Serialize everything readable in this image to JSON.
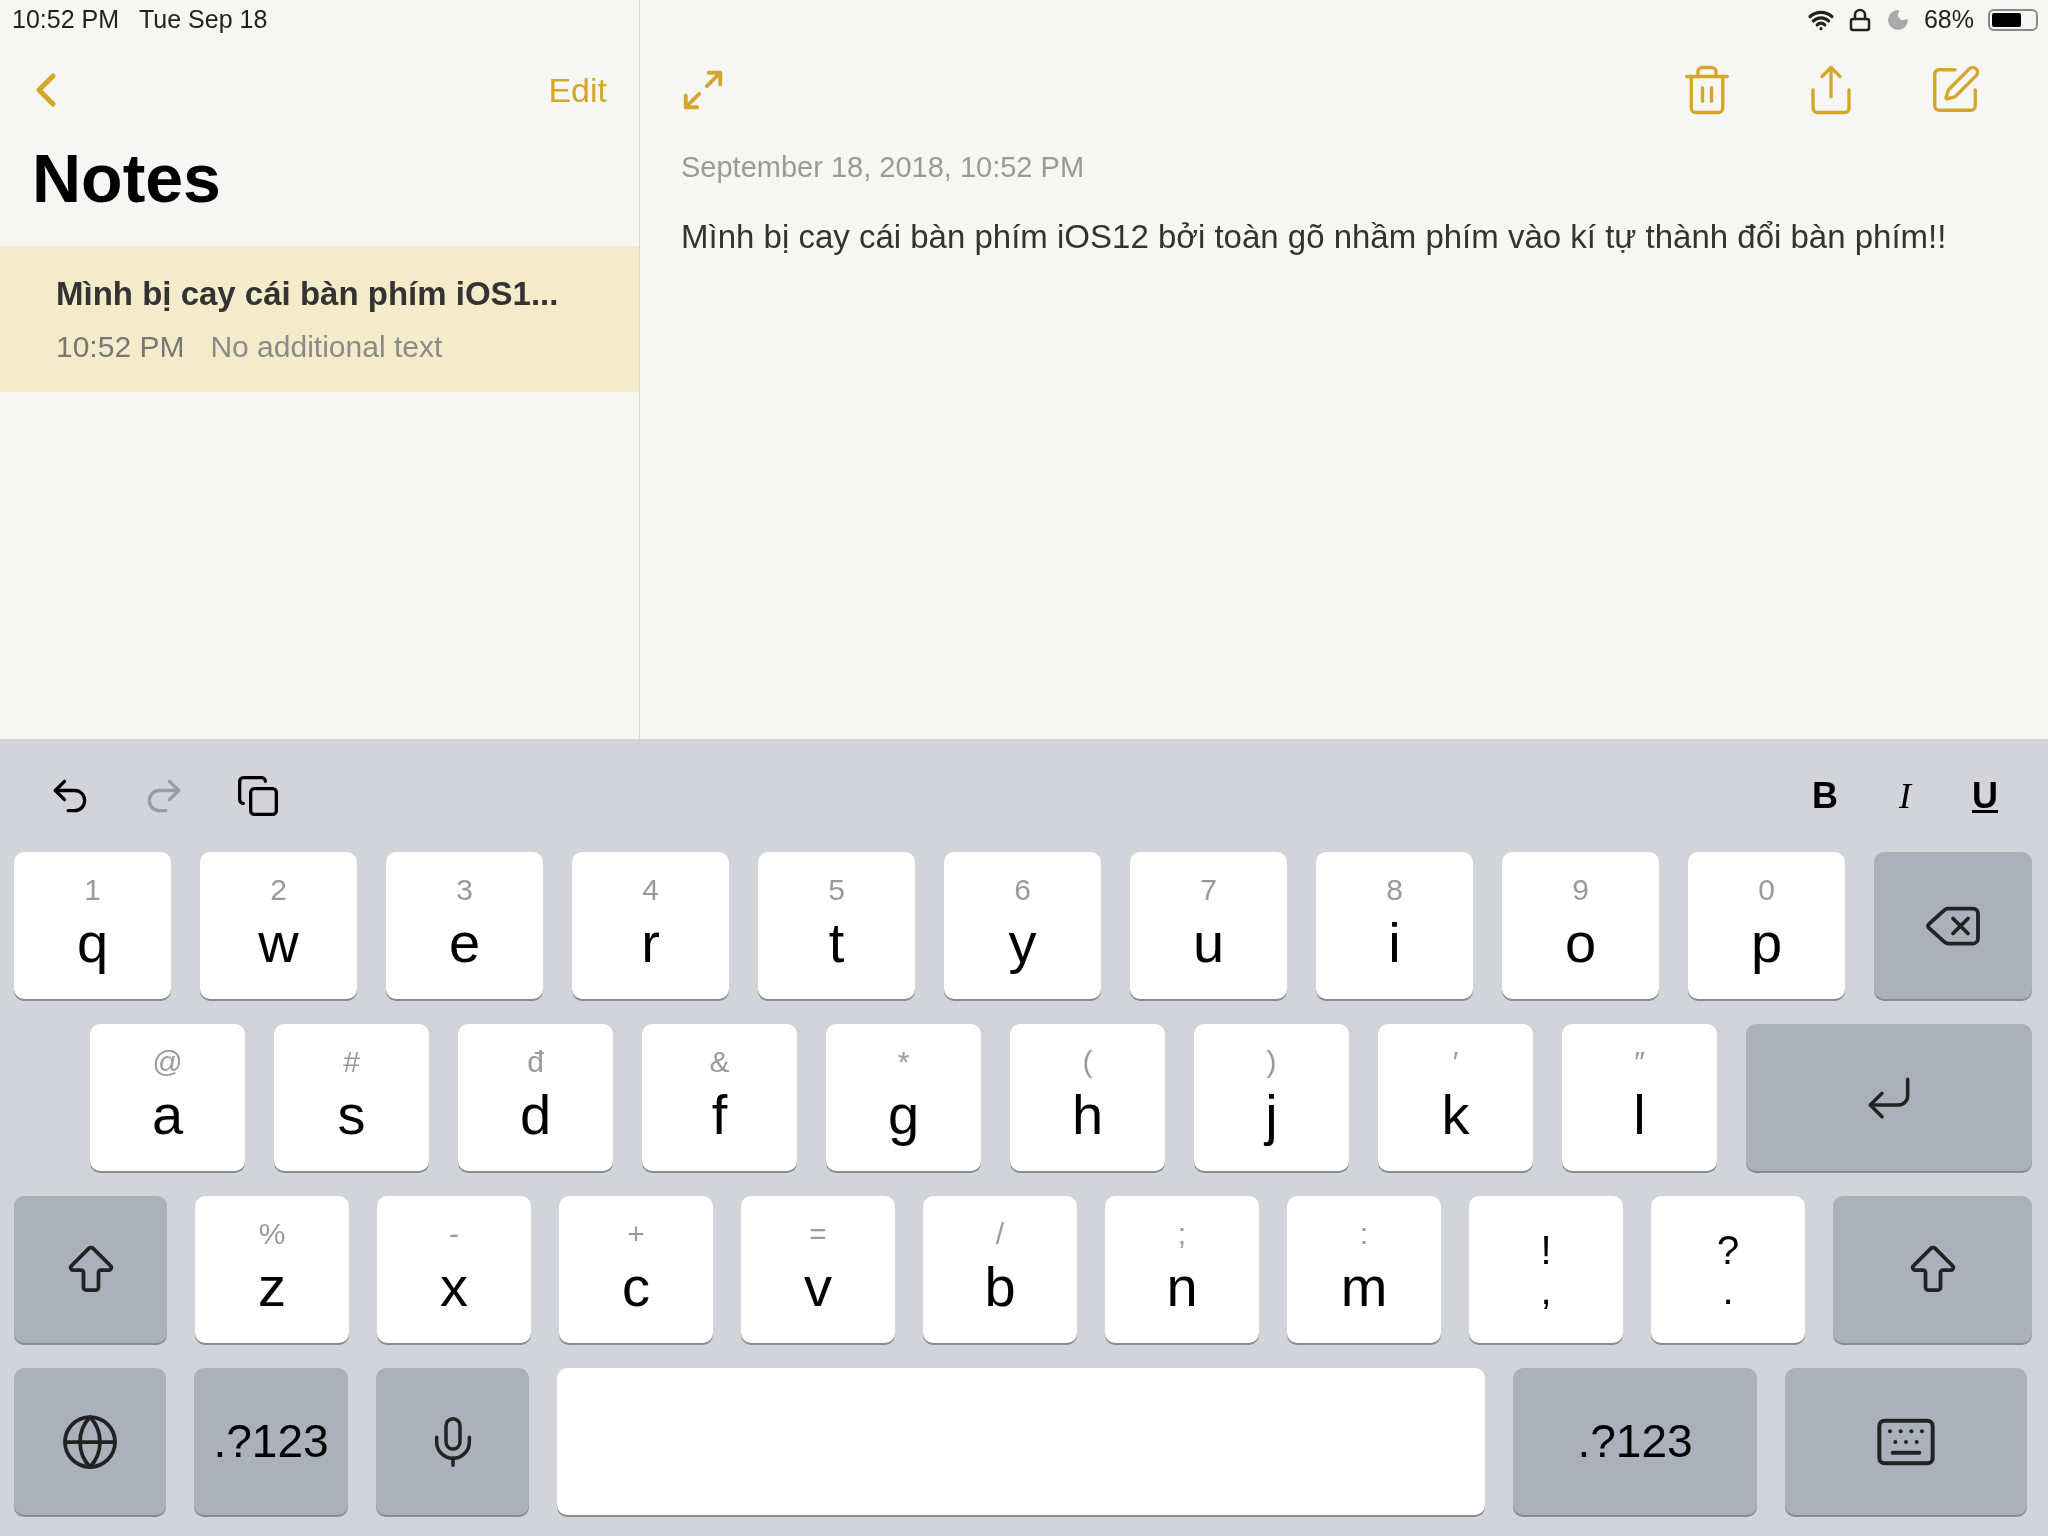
{
  "status_bar": {
    "time": "10:52 PM",
    "date": "Tue Sep 18",
    "battery": "68%"
  },
  "sidebar": {
    "edit": "Edit",
    "title": "Notes",
    "notes": [
      {
        "title": "Mình bị cay cái bàn phím iOS1...",
        "time": "10:52 PM",
        "preview": "No additional text",
        "selected": true
      }
    ]
  },
  "note": {
    "date": "September 18, 2018, 10:52 PM",
    "body": "Mình bị cay cái bàn phím iOS12 bởi toàn gõ nhầm phím vào kí tự thành đổi bàn phím!!"
  },
  "keyboard_toolbar": {
    "actions": [
      {
        "kind": "undo",
        "disabled": false
      },
      {
        "kind": "redo",
        "disabled": true
      },
      {
        "kind": "paste",
        "disabled": false
      }
    ],
    "formats": [
      {
        "kind": "bold",
        "label": "B"
      },
      {
        "kind": "italic",
        "label": "I"
      },
      {
        "kind": "underline",
        "label": "U"
      }
    ]
  },
  "keyboard": {
    "rows": [
      [
        {
          "kind": "letter",
          "label": "q",
          "hint": "1"
        },
        {
          "kind": "letter",
          "label": "w",
          "hint": "2"
        },
        {
          "kind": "letter",
          "label": "e",
          "hint": "3"
        },
        {
          "kind": "letter",
          "label": "r",
          "hint": "4"
        },
        {
          "kind": "letter",
          "label": "t",
          "hint": "5"
        },
        {
          "kind": "letter",
          "label": "y",
          "hint": "6"
        },
        {
          "kind": "letter",
          "label": "u",
          "hint": "7"
        },
        {
          "kind": "letter",
          "label": "i",
          "hint": "8"
        },
        {
          "kind": "letter",
          "label": "o",
          "hint": "9"
        },
        {
          "kind": "letter",
          "label": "p",
          "hint": "0"
        },
        {
          "kind": "delete"
        }
      ],
      [
        {
          "kind": "letter",
          "label": "a",
          "hint": "@"
        },
        {
          "kind": "letter",
          "label": "s",
          "hint": "#"
        },
        {
          "kind": "letter",
          "label": "d",
          "hint": "đ"
        },
        {
          "kind": "letter",
          "label": "f",
          "hint": "&"
        },
        {
          "kind": "letter",
          "label": "g",
          "hint": "*"
        },
        {
          "kind": "letter",
          "label": "h",
          "hint": "("
        },
        {
          "kind": "letter",
          "label": "j",
          "hint": ")"
        },
        {
          "kind": "letter",
          "label": "k",
          "hint": "′"
        },
        {
          "kind": "letter",
          "label": "l",
          "hint": "″"
        },
        {
          "kind": "return"
        }
      ],
      [
        {
          "kind": "shift"
        },
        {
          "kind": "letter",
          "label": "z",
          "hint": "%"
        },
        {
          "kind": "letter",
          "label": "x",
          "hint": "-"
        },
        {
          "kind": "letter",
          "label": "c",
          "hint": "+"
        },
        {
          "kind": "letter",
          "label": "v",
          "hint": "="
        },
        {
          "kind": "letter",
          "label": "b",
          "hint": "/"
        },
        {
          "kind": "letter",
          "label": "n",
          "hint": ";"
        },
        {
          "kind": "letter",
          "label": "m",
          "hint": ":"
        },
        {
          "kind": "punct",
          "label": ",",
          "hint": "!"
        },
        {
          "kind": "punct",
          "label": ".",
          "hint": "?"
        },
        {
          "kind": "shift"
        }
      ],
      [
        {
          "kind": "globe"
        },
        {
          "kind": "mode",
          "label": ".?123"
        },
        {
          "kind": "mic"
        },
        {
          "kind": "space"
        },
        {
          "kind": "mode",
          "label": ".?123"
        },
        {
          "kind": "dismiss"
        }
      ]
    ]
  }
}
